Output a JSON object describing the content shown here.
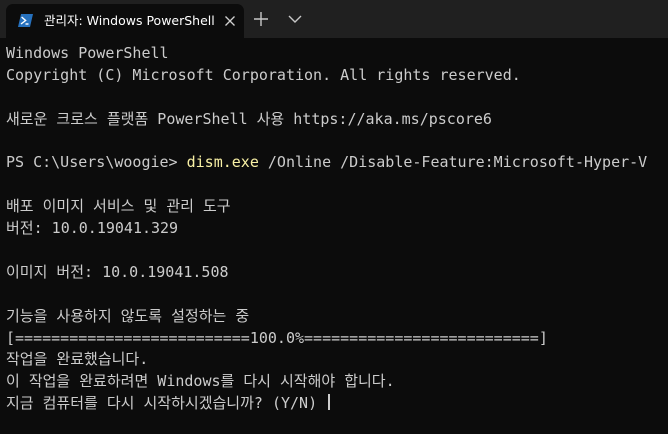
{
  "tab": {
    "title": "관리자: Windows PowerShell",
    "icon": "powershell-icon"
  },
  "colors": {
    "background": "#0c0c0c",
    "tabstrip": "#202020",
    "text": "#cccccc",
    "command": "#f9f1a5",
    "powershell_blue": "#2671be"
  },
  "terminal": {
    "line1": "Windows PowerShell",
    "line2": "Copyright (C) Microsoft Corporation. All rights reserved.",
    "line3": "새로운 크로스 플랫폼 PowerShell 사용 https://aka.ms/pscore6",
    "prompt": "PS C:\\Users\\woogie> ",
    "command": "dism.exe",
    "args": " /Online /Disable-Feature:Microsoft-Hyper-V",
    "line5": "배포 이미지 서비스 및 관리 도구",
    "line6": "버전: 10.0.19041.329",
    "line7": "이미지 버전: 10.0.19041.508",
    "line8": "기능을 사용하지 않도록 설정하는 중",
    "progress": "[==========================100.0%==========================]",
    "line10": "작업을 완료했습니다.",
    "line11": "이 작업을 완료하려면 Windows를 다시 시작해야 합니다.",
    "line12": "지금 컴퓨터를 다시 시작하시겠습니까? (Y/N) "
  }
}
